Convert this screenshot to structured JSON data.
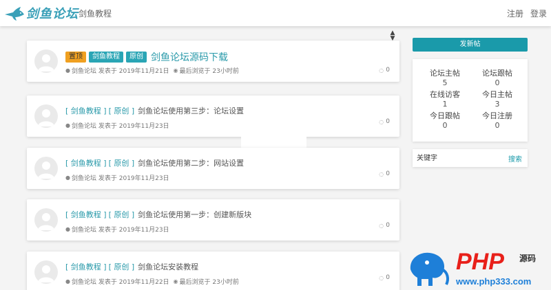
{
  "header": {
    "logo_text": "剑鱼论坛",
    "nav_item": "剑鱼教程",
    "register": "注册",
    "login": "登录"
  },
  "tags": {
    "top": "置顶",
    "category": "剑鱼教程",
    "original": "原创"
  },
  "posts": [
    {
      "title": "剑鱼论坛源码下载",
      "author": "剑鱼论坛",
      "date": "发表于 2019年11月21日",
      "last_view": "最后浏览于 23小时前",
      "replies": "0"
    },
    {
      "cat": "[ 剑鱼教程 ]",
      "orig": "[ 原创 ]",
      "title": "剑鱼论坛使用第三步：论坛设置",
      "author": "剑鱼论坛",
      "date": "发表于 2019年11月23日",
      "replies": "0"
    },
    {
      "cat": "[ 剑鱼教程 ]",
      "orig": "[ 原创 ]",
      "title": "剑鱼论坛使用第二步：网站设置",
      "author": "剑鱼论坛",
      "date": "发表于 2019年11月23日",
      "replies": "0"
    },
    {
      "cat": "[ 剑鱼教程 ]",
      "orig": "[ 原创 ]",
      "title": "剑鱼论坛使用第一步：创建新版块",
      "author": "剑鱼论坛",
      "date": "发表于 2019年11月23日",
      "replies": "0"
    },
    {
      "cat": "[ 剑鱼教程 ]",
      "orig": "[ 原创 ]",
      "title": "剑鱼论坛安装教程",
      "author": "剑鱼论坛",
      "date": "发表于 2019年11月22日",
      "last_view": "最后浏览于 23小时前",
      "replies": "0"
    }
  ],
  "sidebar": {
    "new_post": "发新帖",
    "stats": [
      {
        "label": "论坛主帖",
        "value": "5"
      },
      {
        "label": "论坛跟帖",
        "value": "0"
      },
      {
        "label": "在线访客",
        "value": "1"
      },
      {
        "label": "今日主帖",
        "value": "3"
      },
      {
        "label": "今日跟帖",
        "value": "0"
      },
      {
        "label": "今日注册",
        "value": "0"
      }
    ],
    "search_placeholder": "关键字",
    "search_button": "搜索"
  },
  "watermark": {
    "brand": "PHP",
    "side_text": "源码",
    "url": "www.php333.com"
  },
  "colors": {
    "accent": "#1a9aaa",
    "link": "#2a9aaa",
    "top_tag": "#f0a020",
    "watermark_blue": "#1e7fd8",
    "watermark_red": "#e8201a"
  }
}
